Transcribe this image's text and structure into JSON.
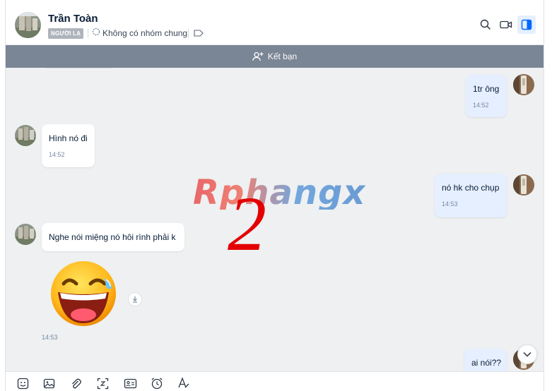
{
  "header": {
    "contact_name": "Trần Toàn",
    "stranger_badge": "NGƯỜI LẠ",
    "group_status": "Không có nhóm chung"
  },
  "add_friend_bar": {
    "label": "Kết bạn"
  },
  "messages": [
    {
      "side": "out",
      "text": "1tr ông",
      "time": "14:52"
    },
    {
      "side": "in",
      "text": "Hình nó đi",
      "time": "14:52"
    },
    {
      "side": "out",
      "text": "nó hk cho chụp",
      "time": "14:53"
    },
    {
      "side": "in",
      "text": "Nghe nói miệng nó hôi rình phải k",
      "time": ""
    },
    {
      "side": "in",
      "type": "sticker",
      "sticker": "laughing-tears-emoji",
      "time": "14:53"
    },
    {
      "side": "out",
      "text": "ai nói??",
      "time": ""
    }
  ],
  "watermark": {
    "brand": "Rphangx",
    "number": "2"
  },
  "toolbar_icons": [
    "sticker-icon",
    "image-icon",
    "attachment-icon",
    "screenshot-icon",
    "contact-card-icon",
    "reminder-icon",
    "text-format-icon"
  ],
  "colors": {
    "accent": "#0068ff",
    "outgoing_bubble": "#e5efff",
    "incoming_bubble": "#ffffff",
    "add_friend_bar": "#7a8595",
    "watermark_number": "#e40000"
  }
}
